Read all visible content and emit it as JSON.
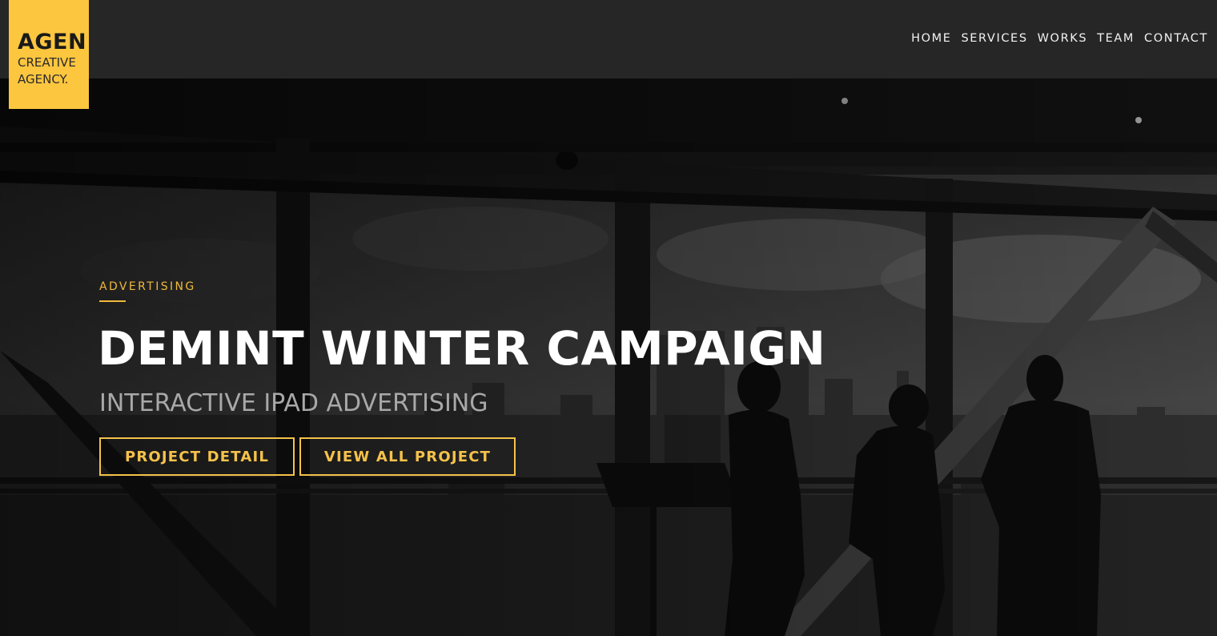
{
  "brand": {
    "name": "AGEN",
    "tagline_line1": "CREATIVE",
    "tagline_line2": "AGENCY.",
    "accent_color": "#fcc63f"
  },
  "nav": {
    "items": [
      {
        "label": "HOME"
      },
      {
        "label": "SERVICES"
      },
      {
        "label": "WORKS"
      },
      {
        "label": "TEAM"
      },
      {
        "label": "CONTACT"
      }
    ]
  },
  "hero": {
    "kicker": "ADVERTISING",
    "title": "DEMINT WINTER CAMPAIGN",
    "subtitle": "INTERACTIVE IPAD ADVERTISING",
    "buttons": {
      "detail_label": "PROJECT DETAIL",
      "all_label": "VIEW ALL PROJECT"
    },
    "background": "grayscale photo of people silhouetted at a skyscraper window overlooking a city skyline"
  }
}
